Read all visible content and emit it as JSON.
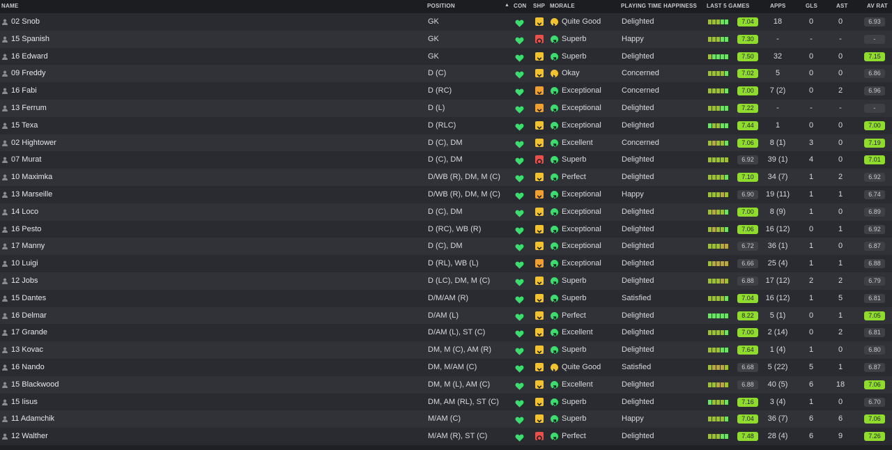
{
  "colors": {
    "green": "#3ddc6f",
    "light_green": "#8fdc2c",
    "yellow": "#f2c230",
    "orange": "#f0a030",
    "red": "#e8504a",
    "rating_bg": "#3f4046"
  },
  "header": {
    "name": "Name",
    "position": "Position",
    "con": "Con",
    "shp": "Shp",
    "morale": "Morale",
    "playing_time": "Playing Time Happiness",
    "last5": "Last 5 Games",
    "apps": "Apps",
    "gls": "Gls",
    "ast": "Ast",
    "avrat": "Av Rat"
  },
  "rows": [
    {
      "name": "02 Snob",
      "position": "GK",
      "shp": "yellow",
      "morale": "Quite Good",
      "morale_icon": "right",
      "playing_time": "Delighted",
      "form": [
        "m",
        "m",
        "m",
        "h",
        "h"
      ],
      "rating": "7.04",
      "rating_hi": true,
      "apps": "18",
      "gls": "0",
      "ast": "0",
      "avrat": "6.93",
      "avrat_hi": false
    },
    {
      "name": "15 Spanish",
      "position": "GK",
      "shp": "red",
      "morale": "Superb",
      "morale_icon": "up",
      "playing_time": "Happy",
      "form": [
        "m",
        "m",
        "m",
        "h",
        "h"
      ],
      "rating": "7.30",
      "rating_hi": true,
      "apps": "-",
      "gls": "-",
      "ast": "-",
      "avrat": "-",
      "avrat_hi": false
    },
    {
      "name": "16 Edward",
      "position": "GK",
      "shp": "yellow",
      "morale": "Superb",
      "morale_icon": "up",
      "playing_time": "Delighted",
      "form": [
        "m",
        "h",
        "h",
        "h",
        "h"
      ],
      "rating": "7.50",
      "rating_hi": true,
      "apps": "32",
      "gls": "0",
      "ast": "0",
      "avrat": "7.15",
      "avrat_hi": true
    },
    {
      "name": "09 Freddy",
      "position": "D (C)",
      "shp": "yellow",
      "morale": "Okay",
      "morale_icon": "right",
      "playing_time": "Concerned",
      "form": [
        "m",
        "m",
        "m",
        "m",
        "h"
      ],
      "rating": "7.02",
      "rating_hi": true,
      "apps": "5",
      "gls": "0",
      "ast": "0",
      "avrat": "6.86",
      "avrat_hi": false
    },
    {
      "name": "16 Fabi",
      "position": "D (RC)",
      "shp": "orange",
      "morale": "Exceptional",
      "morale_icon": "up",
      "playing_time": "Concerned",
      "form": [
        "m",
        "m",
        "m",
        "m",
        "h"
      ],
      "rating": "7.00",
      "rating_hi": true,
      "apps": "7 (2)",
      "gls": "0",
      "ast": "2",
      "avrat": "6.96",
      "avrat_hi": false
    },
    {
      "name": "13 Ferrum",
      "position": "D (L)",
      "shp": "orange",
      "morale": "Exceptional",
      "morale_icon": "up",
      "playing_time": "Delighted",
      "form": [
        "m",
        "m",
        "m",
        "h",
        "h"
      ],
      "rating": "7.22",
      "rating_hi": true,
      "apps": "-",
      "gls": "-",
      "ast": "-",
      "avrat": "-",
      "avrat_hi": false
    },
    {
      "name": "15 Texa",
      "position": "D (RLC)",
      "shp": "yellow",
      "morale": "Exceptional",
      "morale_icon": "up",
      "playing_time": "Delighted",
      "form": [
        "h",
        "m",
        "m",
        "h",
        "h"
      ],
      "rating": "7.44",
      "rating_hi": true,
      "apps": "1",
      "gls": "0",
      "ast": "0",
      "avrat": "7.00",
      "avrat_hi": true
    },
    {
      "name": "02 Hightower",
      "position": "D (C), DM",
      "shp": "yellow",
      "morale": "Excellent",
      "morale_icon": "up",
      "playing_time": "Concerned",
      "form": [
        "m",
        "o",
        "m",
        "m",
        "h"
      ],
      "rating": "7.06",
      "rating_hi": true,
      "apps": "8 (1)",
      "gls": "3",
      "ast": "0",
      "avrat": "7.19",
      "avrat_hi": true
    },
    {
      "name": "07 Murat",
      "position": "D (C), DM",
      "shp": "red",
      "morale": "Superb",
      "morale_icon": "up",
      "playing_time": "Delighted",
      "form": [
        "m",
        "m",
        "m",
        "m",
        "m"
      ],
      "rating": "6.92",
      "rating_hi": false,
      "apps": "39 (1)",
      "gls": "4",
      "ast": "0",
      "avrat": "7.01",
      "avrat_hi": true
    },
    {
      "name": "10 Maximka",
      "position": "D/WB (R), DM, M (C)",
      "shp": "yellow",
      "morale": "Perfect",
      "morale_icon": "up",
      "playing_time": "Delighted",
      "form": [
        "m",
        "m",
        "m",
        "m",
        "h"
      ],
      "rating": "7.10",
      "rating_hi": true,
      "apps": "34 (7)",
      "gls": "1",
      "ast": "2",
      "avrat": "6.92",
      "avrat_hi": false
    },
    {
      "name": "13 Marseille",
      "position": "D/WB (R), DM, M (C)",
      "shp": "orange",
      "morale": "Exceptional",
      "morale_icon": "up",
      "playing_time": "Happy",
      "form": [
        "m",
        "m",
        "m",
        "o",
        "m"
      ],
      "rating": "6.90",
      "rating_hi": false,
      "apps": "19 (11)",
      "gls": "1",
      "ast": "1",
      "avrat": "6.74",
      "avrat_hi": false
    },
    {
      "name": "14 Loco",
      "position": "D (C), DM",
      "shp": "yellow",
      "morale": "Exceptional",
      "morale_icon": "up",
      "playing_time": "Delighted",
      "form": [
        "m",
        "o",
        "m",
        "m",
        "h"
      ],
      "rating": "7.00",
      "rating_hi": true,
      "apps": "8 (9)",
      "gls": "1",
      "ast": "0",
      "avrat": "6.89",
      "avrat_hi": false
    },
    {
      "name": "16 Pesto",
      "position": "D (RC), WB (R)",
      "shp": "yellow",
      "morale": "Exceptional",
      "morale_icon": "up",
      "playing_time": "Delighted",
      "form": [
        "m",
        "o",
        "m",
        "m",
        "h"
      ],
      "rating": "7.06",
      "rating_hi": true,
      "apps": "16 (12)",
      "gls": "0",
      "ast": "1",
      "avrat": "6.92",
      "avrat_hi": false
    },
    {
      "name": "17 Manny",
      "position": "D (C), DM",
      "shp": "yellow",
      "morale": "Exceptional",
      "morale_icon": "up",
      "playing_time": "Delighted",
      "form": [
        "m",
        "m",
        "m",
        "o",
        "o"
      ],
      "rating": "6.72",
      "rating_hi": false,
      "apps": "36 (1)",
      "gls": "1",
      "ast": "0",
      "avrat": "6.87",
      "avrat_hi": false
    },
    {
      "name": "10 Luigi",
      "position": "D (RL), WB (L)",
      "shp": "orange",
      "morale": "Exceptional",
      "morale_icon": "up",
      "playing_time": "Delighted",
      "form": [
        "m",
        "o",
        "o",
        "o",
        "o"
      ],
      "rating": "6.66",
      "rating_hi": false,
      "apps": "25 (4)",
      "gls": "1",
      "ast": "1",
      "avrat": "6.88",
      "avrat_hi": false
    },
    {
      "name": "12 Jobs",
      "position": "D (LC), DM, M (C)",
      "shp": "yellow",
      "morale": "Superb",
      "morale_icon": "up",
      "playing_time": "Delighted",
      "form": [
        "m",
        "m",
        "m",
        "o",
        "m"
      ],
      "rating": "6.88",
      "rating_hi": false,
      "apps": "17 (12)",
      "gls": "2",
      "ast": "2",
      "avrat": "6.79",
      "avrat_hi": false
    },
    {
      "name": "15 Dantes",
      "position": "D/M/AM (R)",
      "shp": "yellow",
      "morale": "Superb",
      "morale_icon": "up",
      "playing_time": "Satisfied",
      "form": [
        "m",
        "m",
        "m",
        "m",
        "h"
      ],
      "rating": "7.04",
      "rating_hi": true,
      "apps": "16 (12)",
      "gls": "1",
      "ast": "5",
      "avrat": "6.81",
      "avrat_hi": false
    },
    {
      "name": "16 Delmar",
      "position": "D/AM (L)",
      "shp": "yellow",
      "morale": "Perfect",
      "morale_icon": "up",
      "playing_time": "Delighted",
      "form": [
        "h",
        "h",
        "h",
        "h",
        "h"
      ],
      "rating": "8.22",
      "rating_hi": true,
      "apps": "5 (1)",
      "gls": "0",
      "ast": "1",
      "avrat": "7.05",
      "avrat_hi": true
    },
    {
      "name": "17 Grande",
      "position": "D/AM (L), ST (C)",
      "shp": "yellow",
      "morale": "Excellent",
      "morale_icon": "up",
      "playing_time": "Delighted",
      "form": [
        "m",
        "m",
        "m",
        "m",
        "h"
      ],
      "rating": "7.00",
      "rating_hi": true,
      "apps": "2 (14)",
      "gls": "0",
      "ast": "2",
      "avrat": "6.81",
      "avrat_hi": false
    },
    {
      "name": "13 Kovac",
      "position": "DM, M (C), AM (R)",
      "shp": "yellow",
      "morale": "Superb",
      "morale_icon": "up",
      "playing_time": "Delighted",
      "form": [
        "m",
        "m",
        "m",
        "h",
        "h"
      ],
      "rating": "7.64",
      "rating_hi": true,
      "apps": "1 (4)",
      "gls": "1",
      "ast": "0",
      "avrat": "6.80",
      "avrat_hi": false
    },
    {
      "name": "16 Nando",
      "position": "DM, M/AM (C)",
      "shp": "yellow",
      "morale": "Quite Good",
      "morale_icon": "right",
      "playing_time": "Satisfied",
      "form": [
        "m",
        "o",
        "o",
        "o",
        "m"
      ],
      "rating": "6.68",
      "rating_hi": false,
      "apps": "5 (22)",
      "gls": "5",
      "ast": "1",
      "avrat": "6.87",
      "avrat_hi": false
    },
    {
      "name": "15 Blackwood",
      "position": "DM, M (L), AM (C)",
      "shp": "yellow",
      "morale": "Excellent",
      "morale_icon": "up",
      "playing_time": "Delighted",
      "form": [
        "m",
        "m",
        "o",
        "o",
        "m"
      ],
      "rating": "6.88",
      "rating_hi": false,
      "apps": "40 (5)",
      "gls": "6",
      "ast": "18",
      "avrat": "7.06",
      "avrat_hi": true
    },
    {
      "name": "15 Iisus",
      "position": "DM, AM (RL), ST (C)",
      "shp": "yellow",
      "morale": "Superb",
      "morale_icon": "up",
      "playing_time": "Delighted",
      "form": [
        "h",
        "m",
        "m",
        "m",
        "h"
      ],
      "rating": "7.16",
      "rating_hi": true,
      "apps": "3 (4)",
      "gls": "1",
      "ast": "0",
      "avrat": "6.70",
      "avrat_hi": false
    },
    {
      "name": "11 Adamchik",
      "position": "M/AM (C)",
      "shp": "yellow",
      "morale": "Superb",
      "morale_icon": "up",
      "playing_time": "Happy",
      "form": [
        "m",
        "m",
        "m",
        "m",
        "h"
      ],
      "rating": "7.04",
      "rating_hi": true,
      "apps": "36 (7)",
      "gls": "6",
      "ast": "6",
      "avrat": "7.06",
      "avrat_hi": true
    },
    {
      "name": "12 Walther",
      "position": "M/AM (R), ST (C)",
      "shp": "red",
      "morale": "Perfect",
      "morale_icon": "up",
      "playing_time": "Delighted",
      "form": [
        "m",
        "m",
        "m",
        "h",
        "h"
      ],
      "rating": "7.48",
      "rating_hi": true,
      "apps": "28 (4)",
      "gls": "6",
      "ast": "9",
      "avrat": "7.26",
      "avrat_hi": true
    }
  ]
}
